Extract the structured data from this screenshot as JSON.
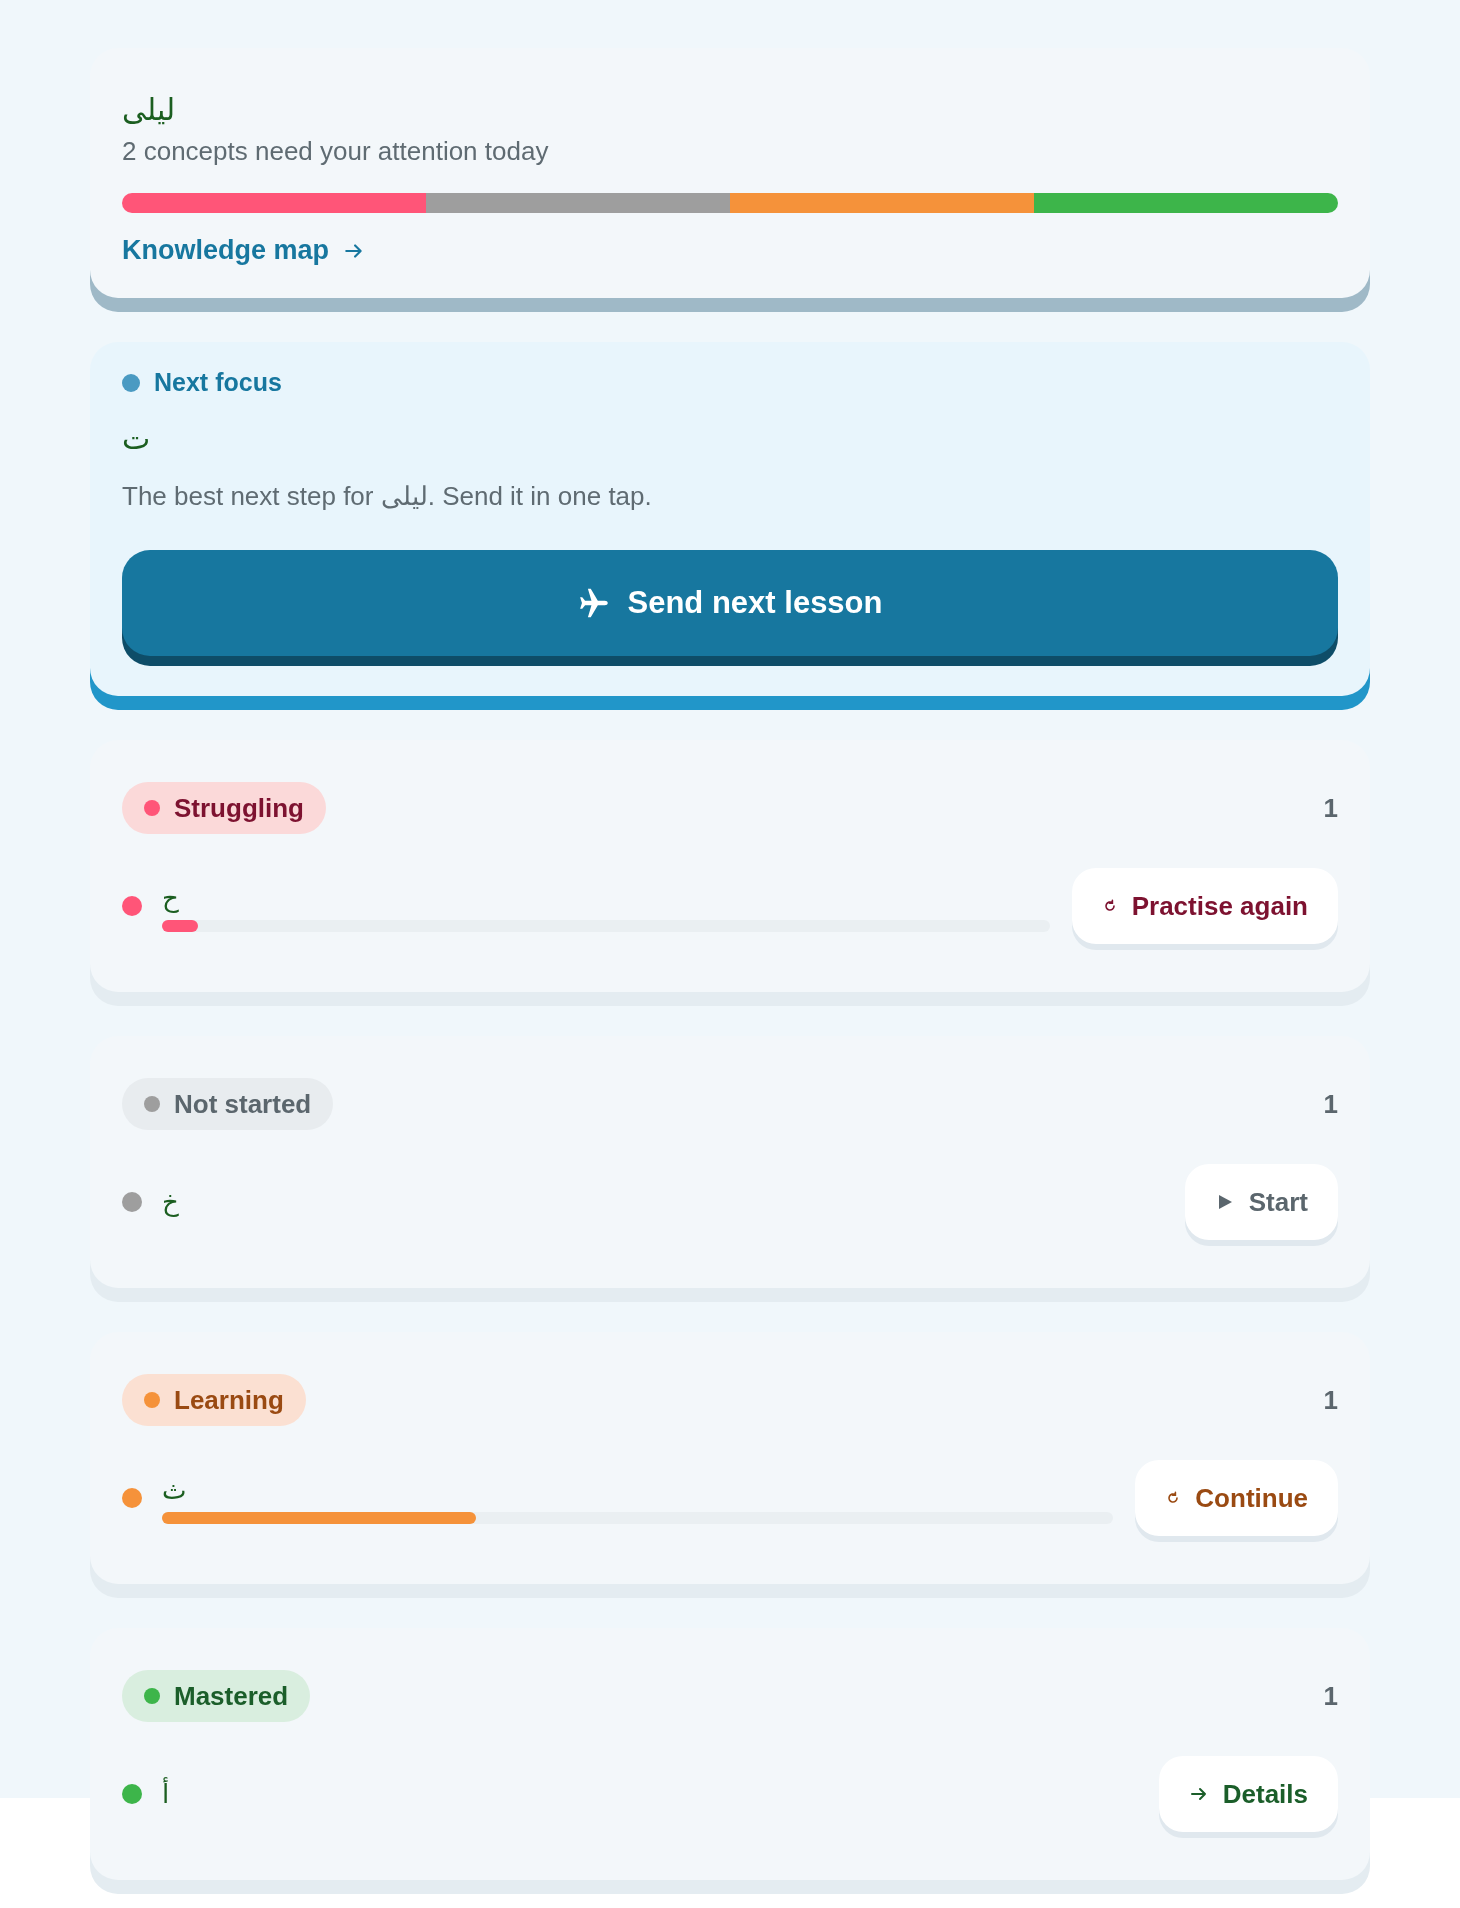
{
  "header": {
    "name": "ليلى",
    "subtitle": "2 concepts need your attention today",
    "segments": [
      {
        "color": "#ff5578"
      },
      {
        "color": "#9e9e9e"
      },
      {
        "color": "#f5923a"
      },
      {
        "color": "#3db54a"
      }
    ],
    "link": "Knowledge map"
  },
  "focus": {
    "label": "Next focus",
    "letter": "ت",
    "text": "The best next step for ليلى. Send it in one tap.",
    "button": "Send next lesson"
  },
  "groups": [
    {
      "kind": "struggling",
      "label": "Struggling",
      "color": "#ff5578",
      "count": "1",
      "items": [
        {
          "letter": "ح",
          "level": 0.04,
          "action": {
            "kind": "retry",
            "label": "Practise again"
          }
        }
      ]
    },
    {
      "kind": "not_started",
      "label": "Not started",
      "color": "#9e9e9e",
      "count": "1",
      "items": [
        {
          "letter": "خ",
          "action": {
            "kind": "play",
            "label": "Start"
          }
        }
      ]
    },
    {
      "kind": "learning",
      "label": "Learning",
      "color": "#f5923a",
      "count": "1",
      "items": [
        {
          "letter": "ث",
          "level": 0.33,
          "action": {
            "kind": "retry",
            "label": "Continue"
          }
        }
      ]
    },
    {
      "kind": "mastered",
      "label": "Mastered",
      "color": "#3db54a",
      "count": "1",
      "items": [
        {
          "letter": "أ",
          "action": {
            "kind": "arrow",
            "label": "Details"
          }
        }
      ]
    }
  ]
}
